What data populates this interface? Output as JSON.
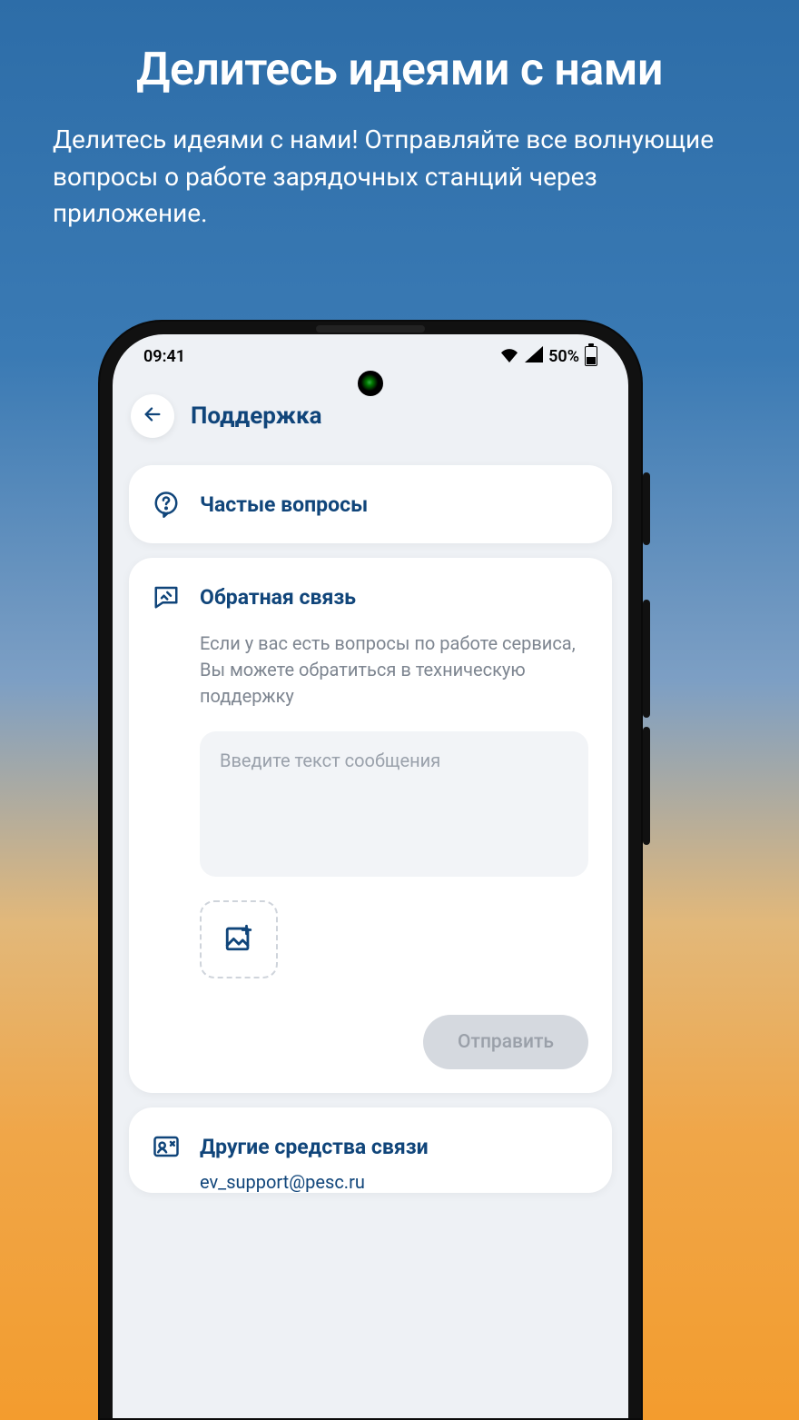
{
  "promo": {
    "title": "Делитесь идеями с нами",
    "subtitle": "Делитесь идеями с нами! Отправляйте все волнующие вопросы о работе зарядочных станций через приложение."
  },
  "status": {
    "time": "09:41",
    "battery_pct": "50%"
  },
  "header": {
    "title": "Поддержка"
  },
  "faq": {
    "title": "Частые вопросы"
  },
  "feedback": {
    "title": "Обратная связь",
    "description": "Если у вас есть вопросы по работе сервиса, Вы можете обратиться в техническую поддержку",
    "placeholder": "Введите текст сообщения",
    "send_label": "Отправить"
  },
  "contacts": {
    "title": "Другие средства связи",
    "email": "ev_support@pesc.ru"
  },
  "colors": {
    "brand": "#10457a",
    "muted": "#7d8590"
  }
}
